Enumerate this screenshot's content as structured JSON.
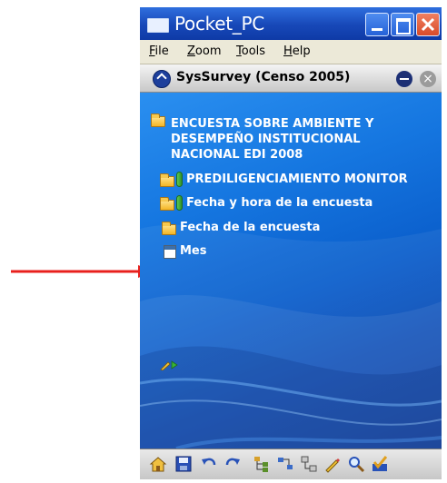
{
  "window": {
    "title": "Pocket_PC"
  },
  "menu": {
    "items": [
      {
        "label": "File",
        "key": "F",
        "rest": "ile"
      },
      {
        "label": "Zoom",
        "key": "Z",
        "rest": "oom"
      },
      {
        "label": "Tools",
        "key": "T",
        "rest": "ools"
      },
      {
        "label": "Help",
        "key": "H",
        "rest": "elp"
      }
    ]
  },
  "app": {
    "title": "SysSurvey  (Censo 2005)"
  },
  "tree": {
    "nodes": [
      {
        "label_lines": [
          "ENCUESTA SOBRE AMBIENTE Y",
          "DESEMPEÑO INSTITUCIONAL",
          "NACIONAL EDI 2008"
        ],
        "icon": "open-folder-icon"
      },
      {
        "label": "PREDILIGENCIAMIENTO MONITOR",
        "icon": "folder-clip-icon"
      },
      {
        "label": "Fecha y hora de la encuesta",
        "icon": "folder-clip-icon"
      },
      {
        "label": "Fecha de la encuesta",
        "icon": "folder-icon"
      },
      {
        "label": "Mes",
        "icon": "calendar-icon"
      },
      {
        "label": "",
        "icon": "pencil-icon"
      }
    ]
  },
  "toolbar": {
    "icons": [
      "home-icon",
      "save-icon",
      "undo-icon",
      "redo-icon",
      "tree-icon",
      "connector-icon",
      "structure-icon",
      "edit-icon",
      "search-icon",
      "check-icon"
    ]
  },
  "colors": {
    "titlebar": "#1748b8",
    "content": "#1576e0",
    "arrow": "#e8201c"
  }
}
